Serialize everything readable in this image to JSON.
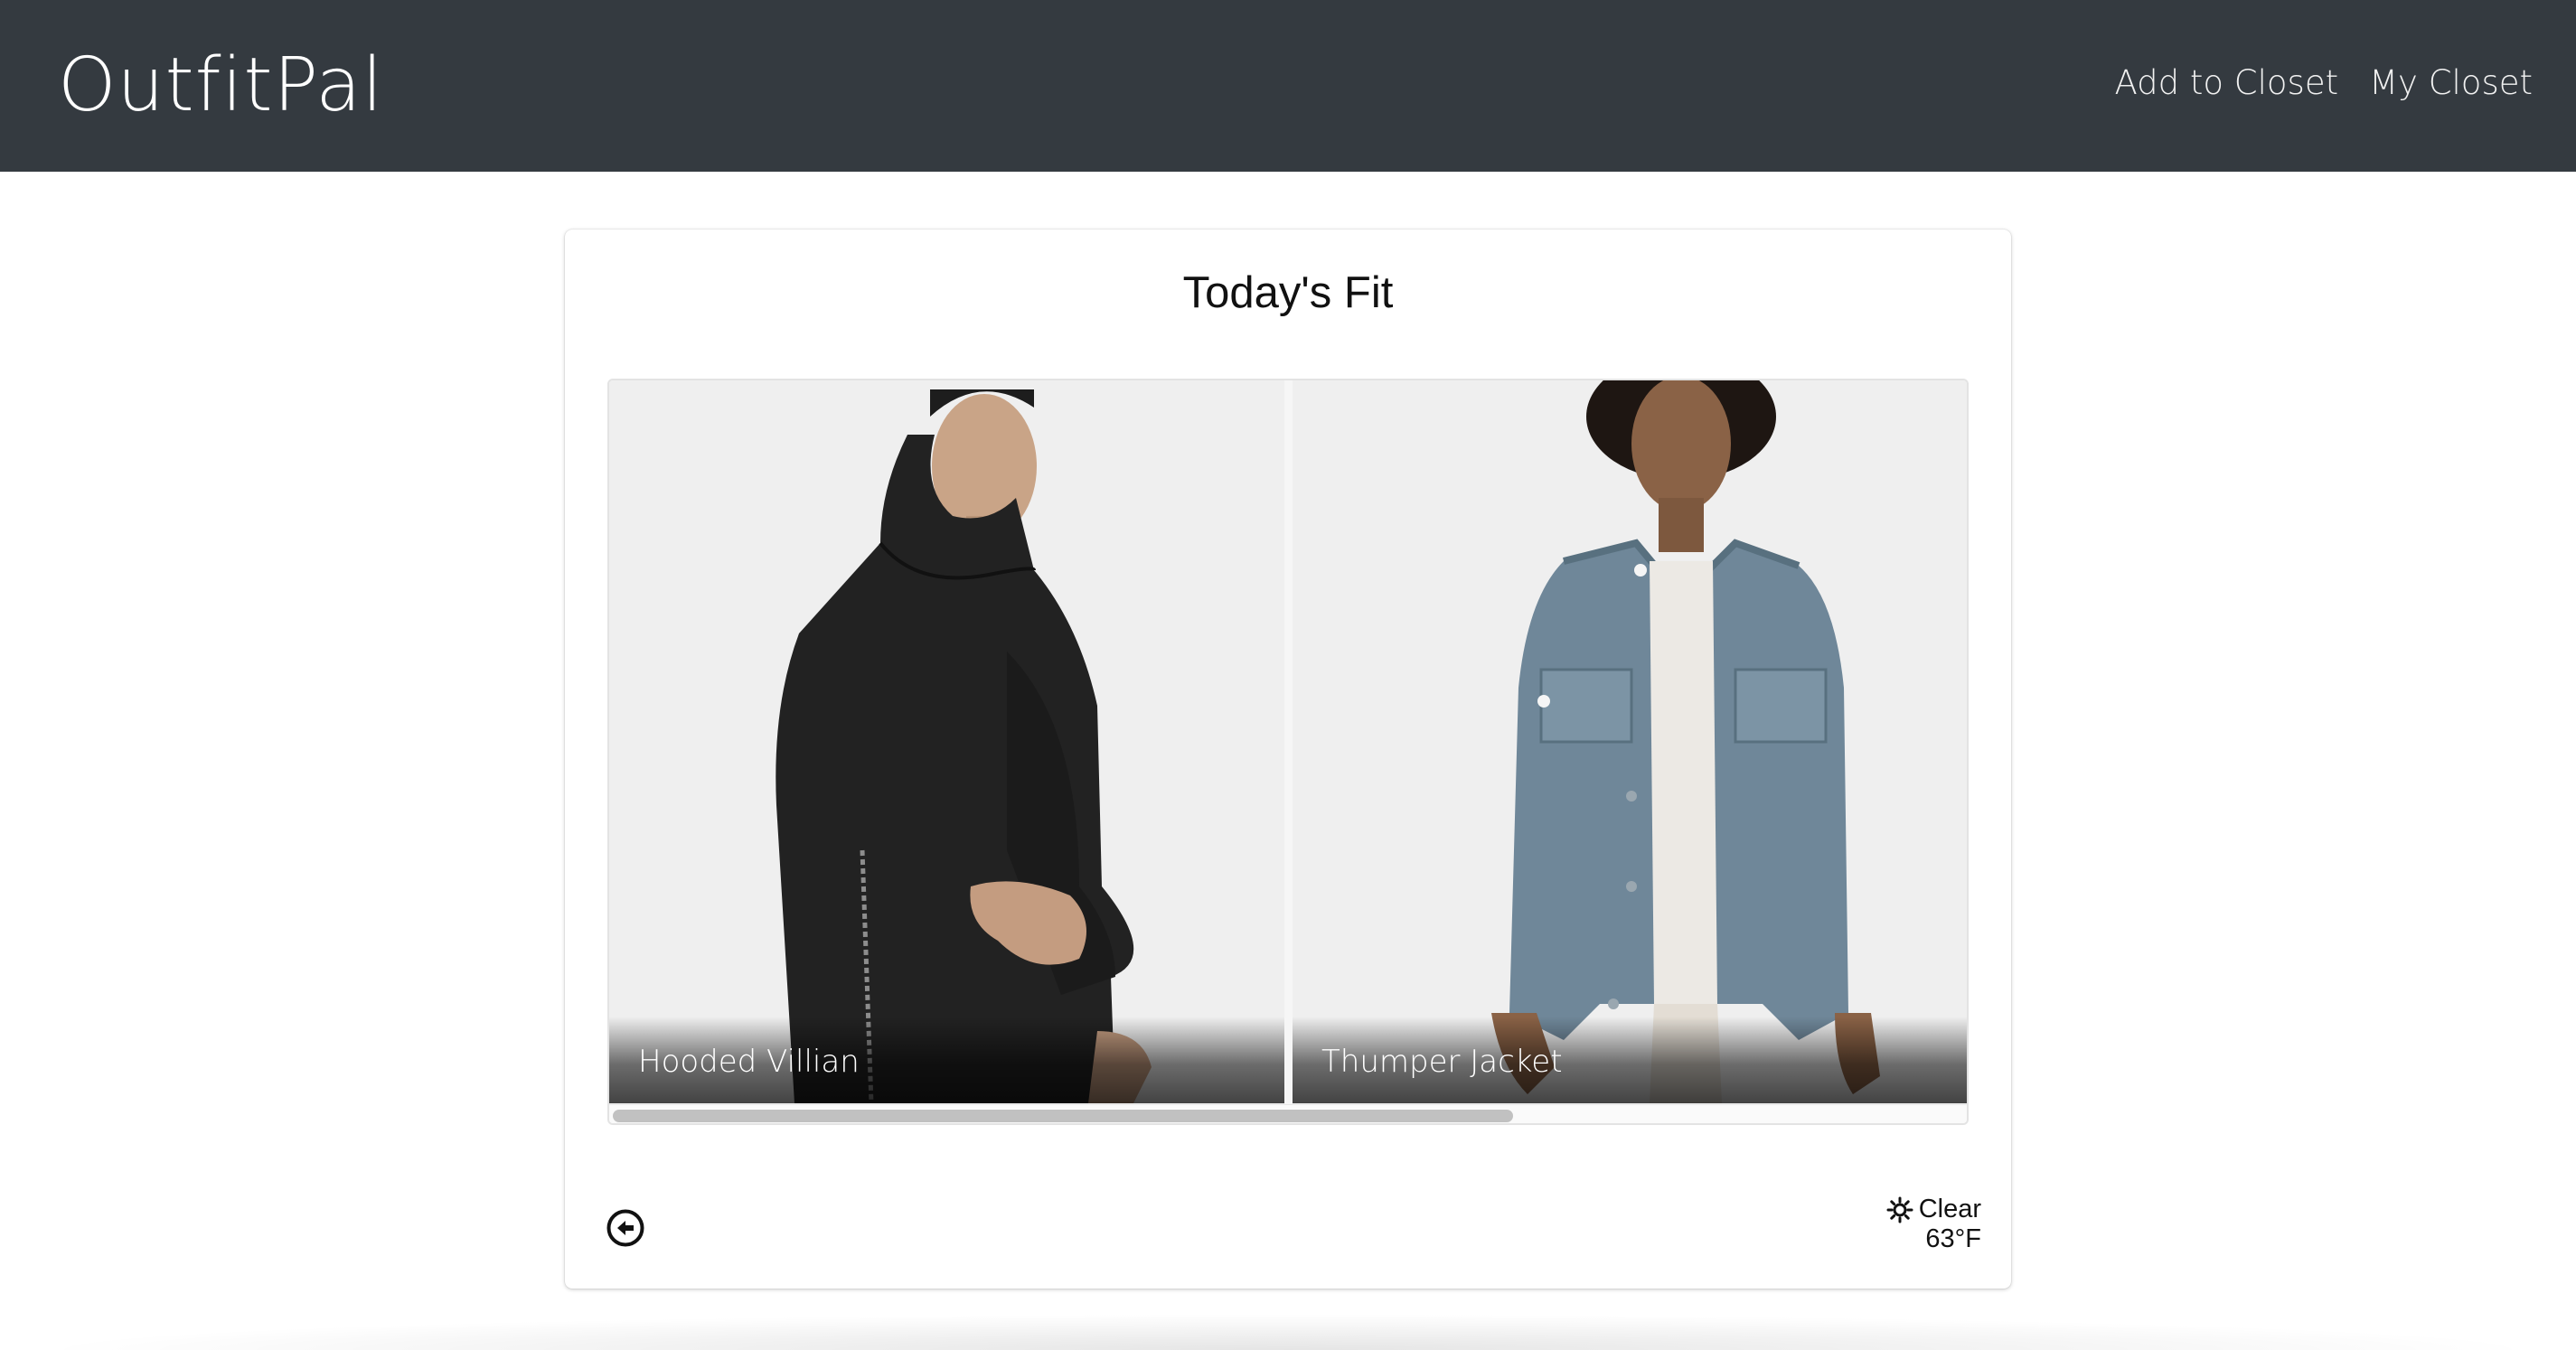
{
  "navbar": {
    "brand": "OutfitPal",
    "links": [
      {
        "label": "Add to Closet"
      },
      {
        "label": "My Closet"
      }
    ]
  },
  "card": {
    "title": "Today's Fit",
    "items": [
      {
        "name": "Hooded Villian",
        "image": "black hoodie model"
      },
      {
        "name": "Thumper Jacket",
        "image": "denim jacket model"
      }
    ],
    "back_icon": "arrow-left-circle-icon",
    "weather": {
      "icon": "sun-icon",
      "condition": "Clear",
      "temperature": "63°F"
    }
  },
  "colors": {
    "navbar_bg": "#343a40",
    "page_bg": "#ffffff",
    "text": "#111111"
  }
}
